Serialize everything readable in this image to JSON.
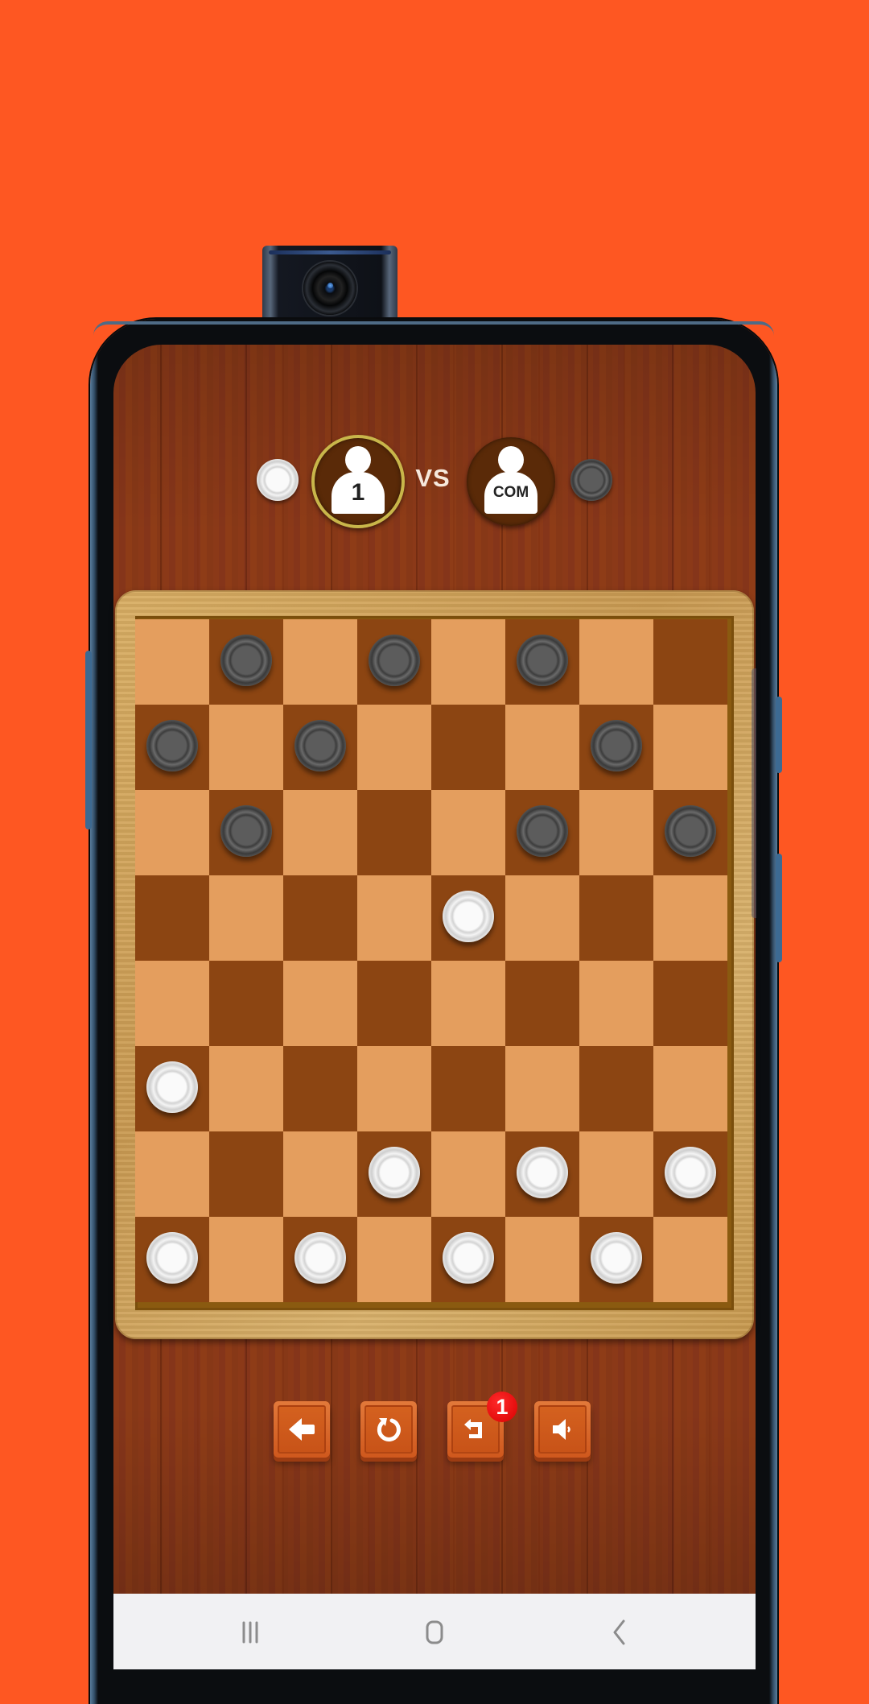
{
  "app": {
    "name": "Checkers",
    "background_color": "#fe5722"
  },
  "players": {
    "player1": {
      "label": "1",
      "piece_color": "white",
      "active": true
    },
    "vs_label": "VS",
    "player2": {
      "label": "COM",
      "piece_color": "black",
      "active": false
    }
  },
  "board": {
    "rows": 8,
    "cols": 8,
    "colors": {
      "light": "#e49e5e",
      "dark": "#8c4512"
    },
    "pieces": [
      {
        "row": 0,
        "col": 1,
        "color": "black"
      },
      {
        "row": 0,
        "col": 3,
        "color": "black"
      },
      {
        "row": 0,
        "col": 5,
        "color": "black"
      },
      {
        "row": 1,
        "col": 0,
        "color": "black"
      },
      {
        "row": 1,
        "col": 2,
        "color": "black"
      },
      {
        "row": 1,
        "col": 6,
        "color": "black"
      },
      {
        "row": 2,
        "col": 1,
        "color": "black"
      },
      {
        "row": 2,
        "col": 5,
        "color": "black"
      },
      {
        "row": 2,
        "col": 7,
        "color": "black"
      },
      {
        "row": 3,
        "col": 4,
        "color": "white"
      },
      {
        "row": 5,
        "col": 0,
        "color": "white"
      },
      {
        "row": 6,
        "col": 3,
        "color": "white"
      },
      {
        "row": 6,
        "col": 5,
        "color": "white"
      },
      {
        "row": 6,
        "col": 7,
        "color": "white"
      },
      {
        "row": 7,
        "col": 0,
        "color": "white"
      },
      {
        "row": 7,
        "col": 2,
        "color": "white"
      },
      {
        "row": 7,
        "col": 4,
        "color": "white"
      },
      {
        "row": 7,
        "col": 6,
        "color": "white"
      }
    ]
  },
  "controls": {
    "back": {
      "icon": "arrow-left-icon"
    },
    "restart": {
      "icon": "refresh-icon"
    },
    "undo": {
      "icon": "undo-icon",
      "badge": "1"
    },
    "sound": {
      "icon": "speaker-icon"
    }
  },
  "navbar": {
    "recents": "recent-apps-icon",
    "home": "home-icon",
    "back": "back-icon"
  }
}
